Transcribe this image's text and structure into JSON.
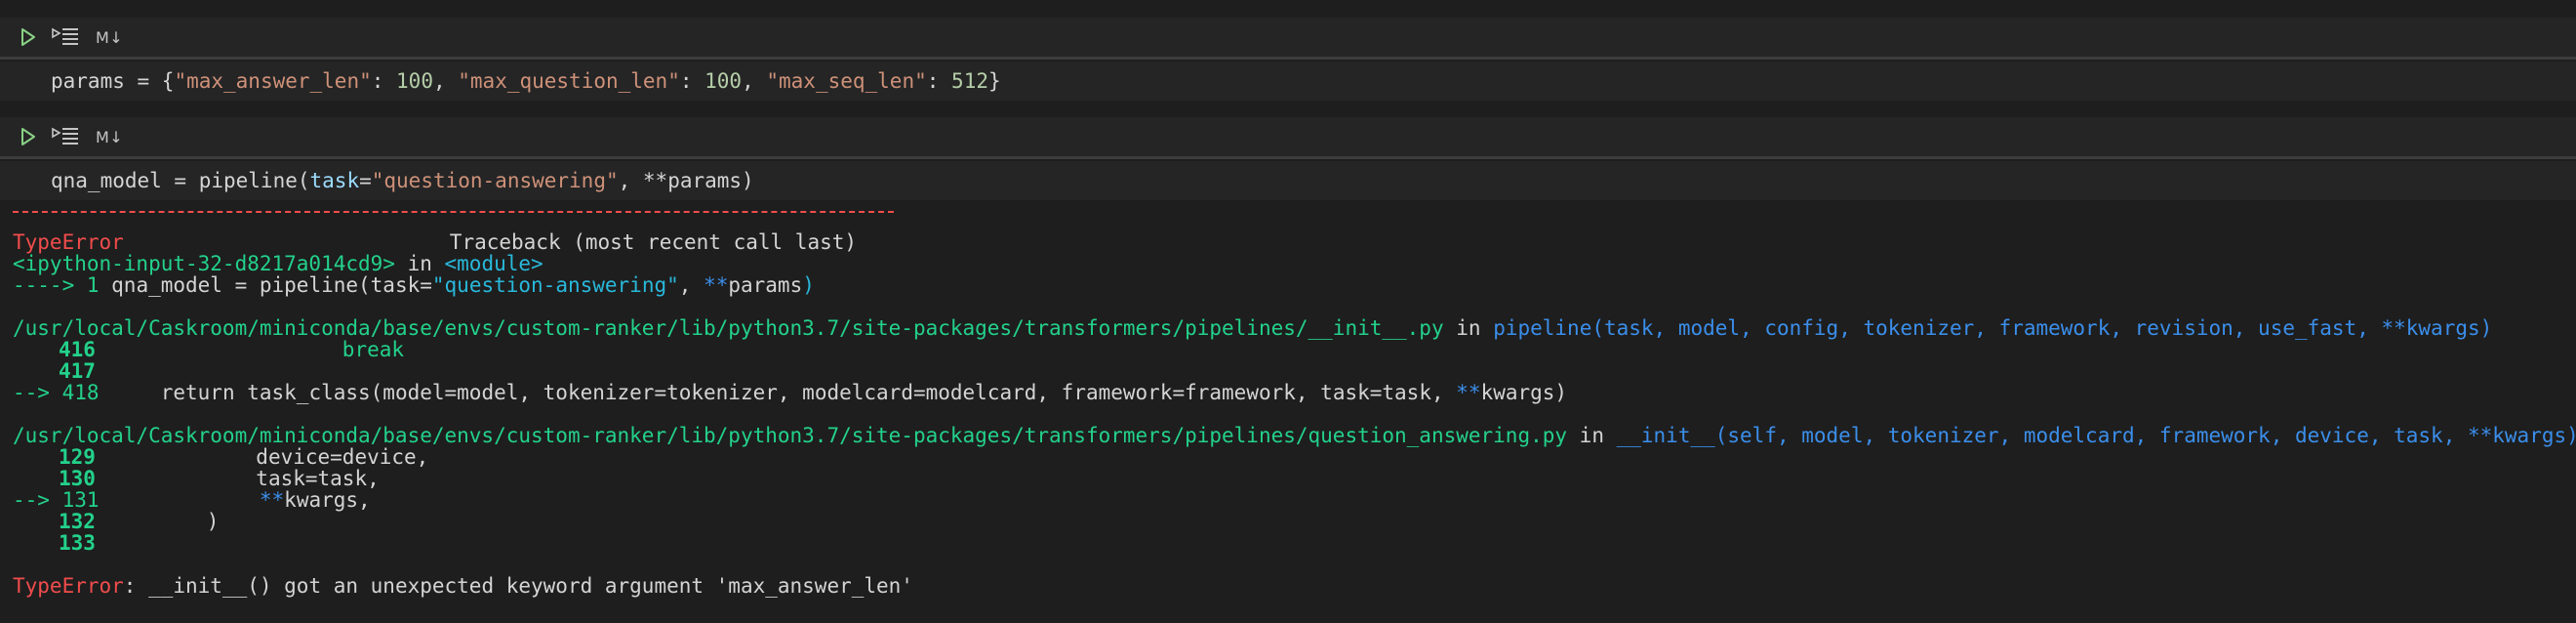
{
  "cells": [
    {
      "toolbar": {
        "run_icon": "play-icon",
        "run_below_icon": "run-by-line-icon",
        "type_badge": "M↓"
      },
      "code": {
        "var": "params",
        "op": " = {",
        "k1": "\"max_answer_len\"",
        "sep1": ": ",
        "v1": "100",
        "c1": ", ",
        "k2": "\"max_question_len\"",
        "sep2": ": ",
        "v2": "100",
        "c2": ", ",
        "k3": "\"max_seq_len\"",
        "sep3": ": ",
        "v3": "512",
        "end": "}"
      }
    },
    {
      "toolbar": {
        "run_icon": "play-icon",
        "run_below_icon": "run-by-line-icon",
        "type_badge": "M↓"
      },
      "code": {
        "pre": "qna_model = pipeline(",
        "kw": "task",
        "eq": "=",
        "str": "\"question-answering\"",
        "post": ", **params)"
      }
    }
  ],
  "output": {
    "header_error": "TypeError",
    "header_traceback": "Traceback (most recent call last)",
    "input_ref": "<ipython-input-32-d8217a014cd9>",
    "input_in": " in ",
    "input_module": "<module>",
    "arrow1": "----> 1 ",
    "arrow1_code_pre": "qna_model = pipeline(task=",
    "arrow1_str": "\"question-answering\"",
    "arrow1_comma": ", ",
    "arrow1_kw": "**",
    "arrow1_params": "params",
    "arrow1_close": ")",
    "frame1_path": "/usr/local/Caskroom/miniconda/base/envs/custom-ranker/lib/python3.7/site-packages/transformers/pipelines/__init__.py",
    "frame1_in": " in ",
    "frame1_sig": "pipeline(task, model, config, tokenizer, framework, revision, use_fast, **kwargs)",
    "f1_l416_num": "416",
    "f1_l416_code": "                    break",
    "f1_l417_num": "417",
    "f1_l418_arrow": "--> 418",
    "f1_l418_code_a": "     return task_class(model=model, tokenizer=tokenizer, modelcard=modelcard, framework=framework, task=task, ",
    "f1_l418_kw": "**",
    "f1_l418_code_b": "kwargs)",
    "frame2_path": "/usr/local/Caskroom/miniconda/base/envs/custom-ranker/lib/python3.7/site-packages/transformers/pipelines/question_answering.py",
    "frame2_in": " in ",
    "frame2_sig": "__init__(self, model, tokenizer, modelcard, framework, device, task, **kwargs)",
    "f2_l129_num": "129",
    "f2_l129_code": "             device=device,",
    "f2_l130_num": "130",
    "f2_l130_code": "             task=task,",
    "f2_l131_arrow": "--> 131",
    "f2_l131_kw": "             **",
    "f2_l131_code": "kwargs,",
    "f2_l132_num": "132",
    "f2_l132_code": "         )",
    "f2_l133_num": "133",
    "final_error": "TypeError",
    "final_msg": ": __init__() got an unexpected keyword argument 'max_answer_len'"
  }
}
